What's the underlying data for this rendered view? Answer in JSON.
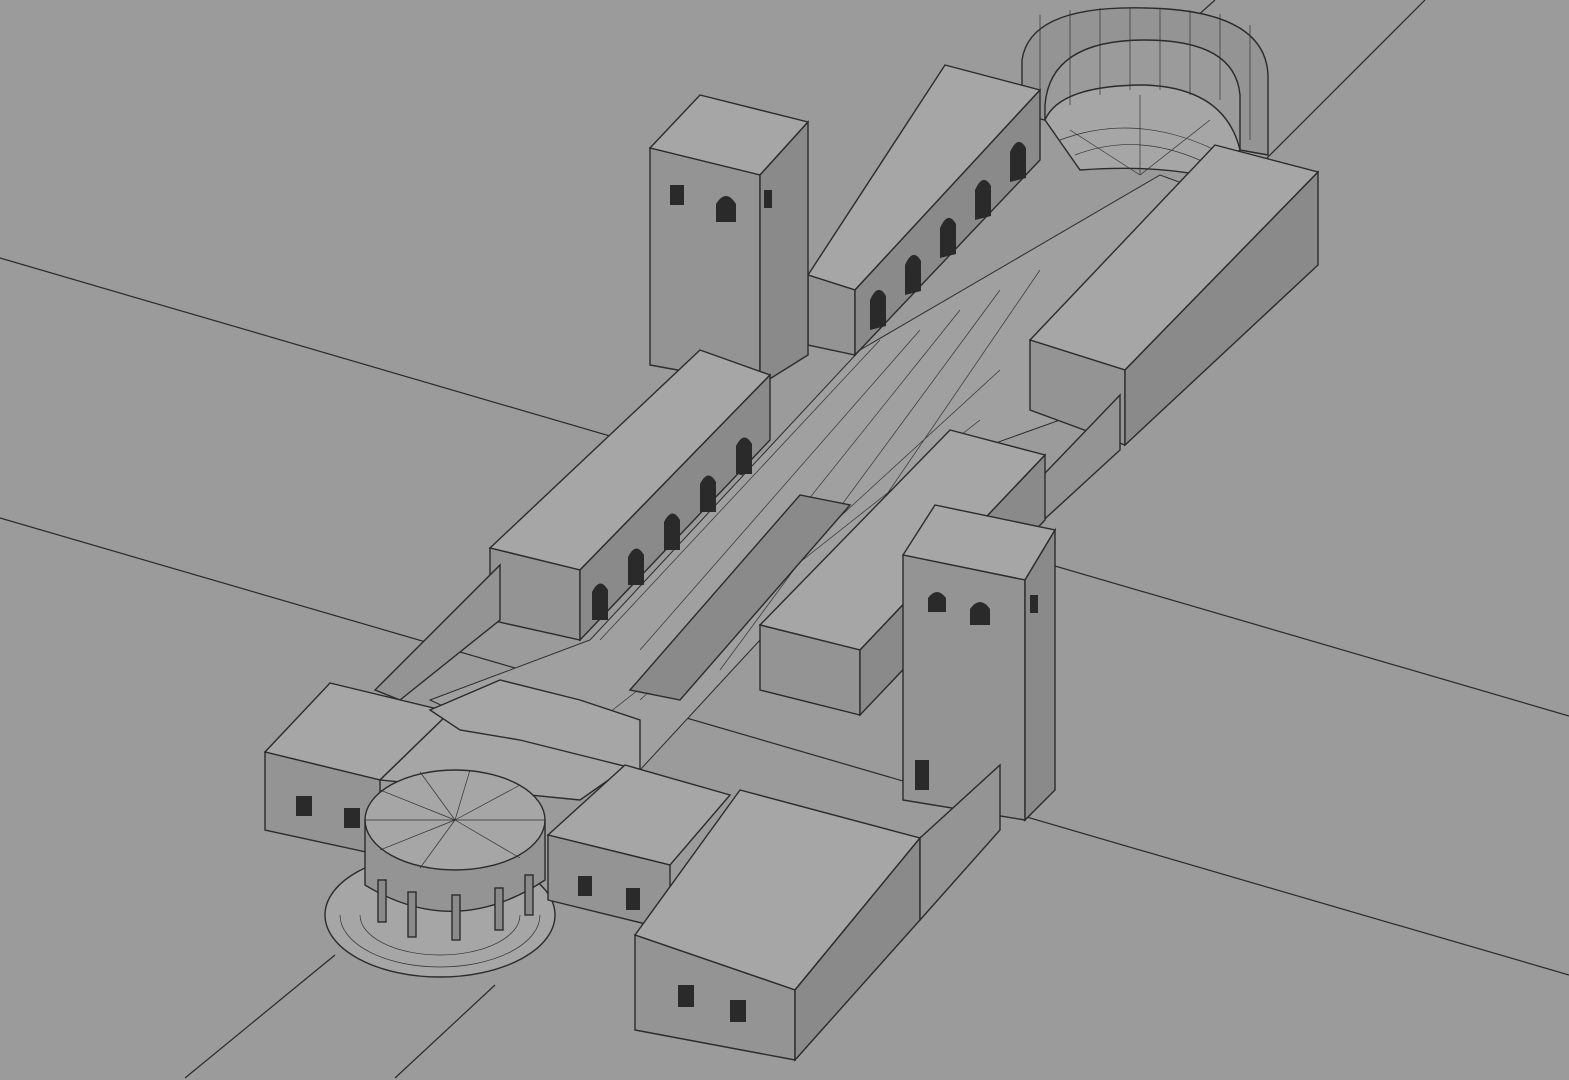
{
  "viewport": {
    "background_color": "#9b9b9b",
    "top_face_color": "#a6a6a6",
    "wall_color": "#949494",
    "edge_color": "#2b2b2b"
  }
}
